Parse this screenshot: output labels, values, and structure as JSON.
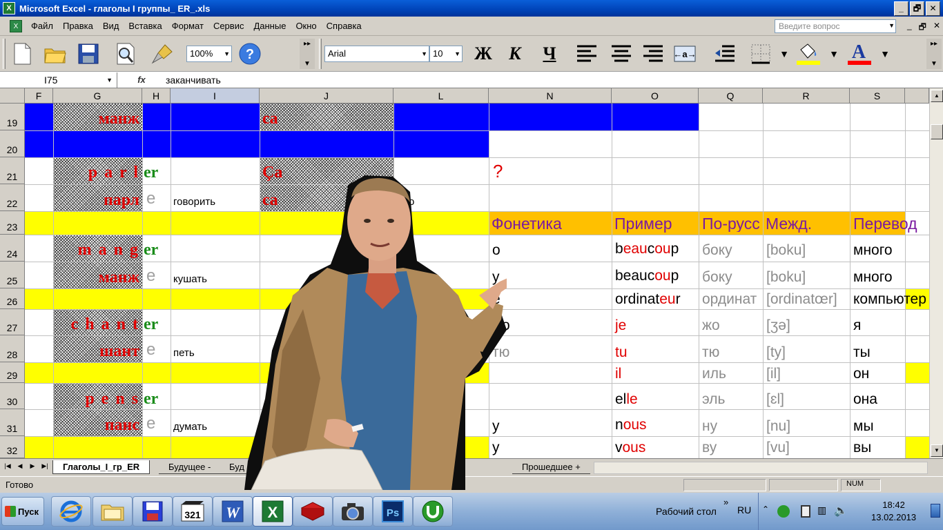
{
  "window": {
    "title": "Microsoft Excel - глаголы I группы_ ER_.xls",
    "min": "_",
    "max": "🗗",
    "close": "✕"
  },
  "menu": {
    "items": [
      "Файл",
      "Правка",
      "Вид",
      "Вставка",
      "Формат",
      "Сервис",
      "Данные",
      "Окно",
      "Справка"
    ],
    "help_placeholder": "Введите вопрос",
    "doc_min": "_",
    "doc_max": "🗗",
    "doc_close": "✕"
  },
  "toolbar": {
    "zoom": "100%",
    "font": "Arial",
    "size": "10",
    "bold": "Ж",
    "italic": "К",
    "underline": "Ч",
    "fill_color": "#ffff00",
    "font_color": "#ff0000"
  },
  "formula": {
    "cell_ref": "I75",
    "fx": "fx",
    "value": "заканчивать"
  },
  "columns": [
    "F",
    "G",
    "H",
    "I",
    "J",
    "L",
    "N",
    "O",
    "Q",
    "R",
    "S"
  ],
  "rows": [
    "19",
    "20",
    "21",
    "22",
    "23",
    "24",
    "25",
    "26",
    "27",
    "28",
    "29",
    "30",
    "31",
    "32"
  ],
  "cells": {
    "g19": "манж",
    "j19": "ca",
    "n21": "?",
    "g21": "p a r l",
    "h21": "er",
    "j21": "Ça",
    "g22": "парл",
    "h22": "е",
    "i22": "говорить",
    "j22": "ca",
    "l22": "о",
    "n23": "Фонетика",
    "o23": "Пример",
    "q23": "По-русс",
    "r23": "Межд.",
    "s23": "Перевод",
    "g24": "m a n g",
    "h24": "er",
    "n24": "о",
    "o24a": "b",
    "o24b": "eau",
    "o24c": "c",
    "o24d": "ou",
    "o24e": "p",
    "q24": "боку",
    "r24": "[boku]",
    "s24": "много",
    "g25": "манж",
    "h25": "е",
    "i25": "кушать",
    "n25": "у",
    "o25a": "beauc",
    "o25b": "ou",
    "o25c": "p",
    "q25": "боку",
    "r25": "[boku]",
    "s25": "много",
    "n26": "ё",
    "o26a": "ordinat",
    "o26b": "eu",
    "o26c": "r",
    "q26": "ординат",
    "r26": "[ordinatœr]",
    "s26": "компьютер",
    "g27": "c h a n t",
    "h27": "er",
    "n27": "жо",
    "o27": "je",
    "q27": "жо",
    "r27": "[ʒə]",
    "s27": "я",
    "g28": "шант",
    "h28": "е",
    "i28": "петь",
    "n28": "тю",
    "o28": "tu",
    "q28": "тю",
    "r28": "[ty]",
    "s28": "ты",
    "o29": "il",
    "q29": "иль",
    "r29": "[il]",
    "s29": "он",
    "g30": "p e n s",
    "h30": "er",
    "o30a": "el",
    "o30b": "le",
    "q30": "эль",
    "r30": "[ɛl]",
    "s30": "она",
    "g31": "панс",
    "h31": "е",
    "i31": "думать",
    "n31": "у",
    "o31a": "n",
    "o31b": "ous",
    "q31": "ну",
    "r31": "[nu]",
    "s31": "мы",
    "n32": "у",
    "o32a": "v",
    "o32b": "ous",
    "q32": "ву",
    "r32": "[vu]",
    "s32": "вы"
  },
  "sheets": {
    "active": "Глаголы_I_гр_ER",
    "tab2": "Будущее -",
    "tab3": "Буд",
    "tab4": "Прошедшее +"
  },
  "status": {
    "ready": "Готово",
    "num": "NUM"
  },
  "taskbar": {
    "start": "Пуск",
    "desktop": "Рабочий стол",
    "chevron": "»",
    "lang": "RU",
    "time": "18:42",
    "date": "13.02.2013"
  },
  "overlay": {
    "description_icon": "presenter-cutout"
  }
}
